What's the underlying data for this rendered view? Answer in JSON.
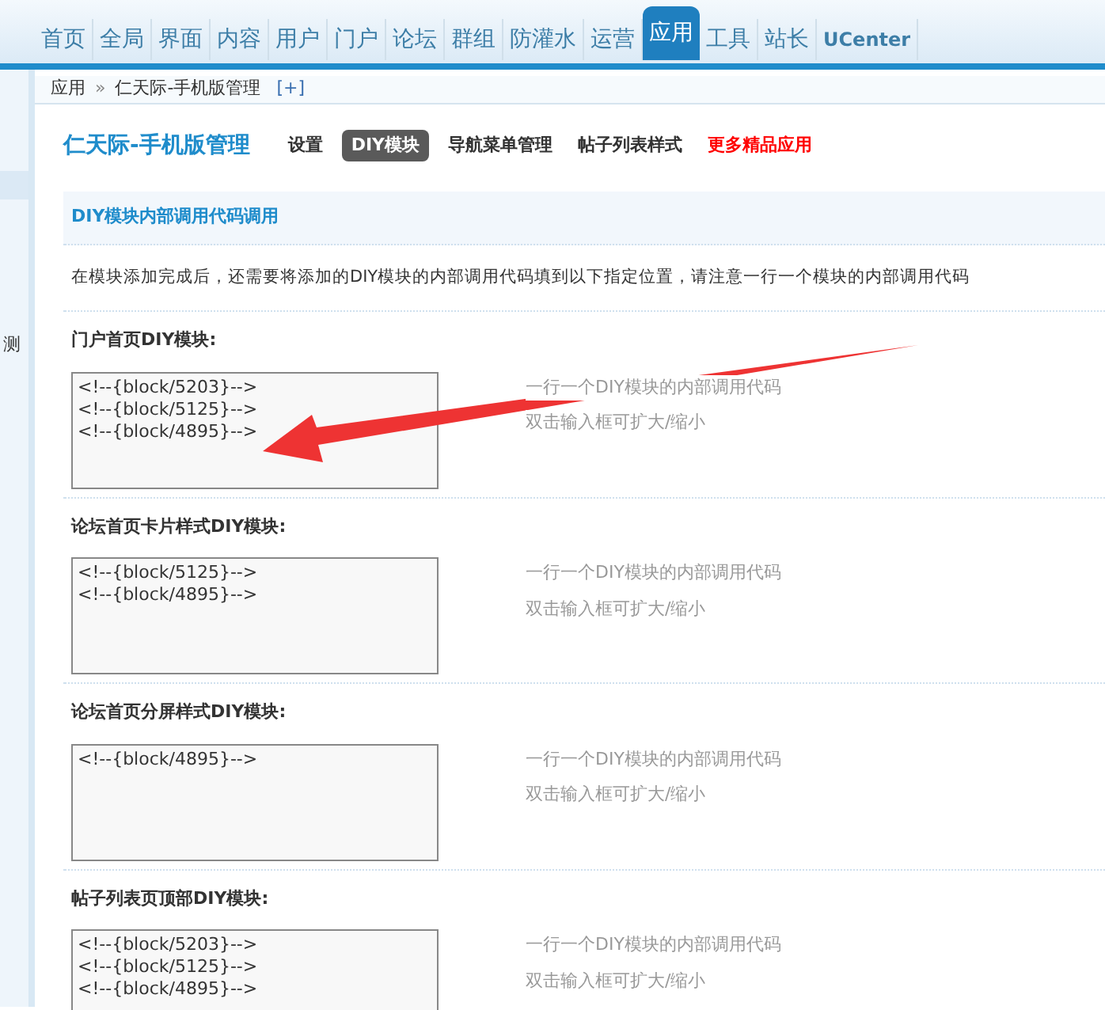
{
  "nav": {
    "items": [
      {
        "label": "首页",
        "selected": false
      },
      {
        "label": "全局",
        "selected": false
      },
      {
        "label": "界面",
        "selected": false
      },
      {
        "label": "内容",
        "selected": false
      },
      {
        "label": "用户",
        "selected": false
      },
      {
        "label": "门户",
        "selected": false
      },
      {
        "label": "论坛",
        "selected": false
      },
      {
        "label": "群组",
        "selected": false
      },
      {
        "label": "防灌水",
        "selected": false
      },
      {
        "label": "运营",
        "selected": false
      },
      {
        "label": "应用",
        "selected": true
      },
      {
        "label": "工具",
        "selected": false
      },
      {
        "label": "站长",
        "selected": false
      },
      {
        "label": "UCenter",
        "selected": false
      }
    ]
  },
  "sidebar": {
    "items": [
      {
        "label": "测"
      }
    ]
  },
  "breadcrumb": {
    "root": "应用",
    "separator": "»",
    "current": "仁天际-手机版管理",
    "add": "[+]"
  },
  "plugin": {
    "title": "仁天际-手机版管理",
    "tabs": [
      {
        "label": "设置",
        "selected": false,
        "kind": "normal"
      },
      {
        "label": "DIY模块",
        "selected": true,
        "kind": "normal"
      },
      {
        "label": "导航菜单管理",
        "selected": false,
        "kind": "normal"
      },
      {
        "label": "帖子列表样式",
        "selected": false,
        "kind": "normal"
      },
      {
        "label": "更多精品应用",
        "selected": false,
        "kind": "promo"
      }
    ]
  },
  "panel": {
    "title": "DIY模块内部调用代码调用",
    "description": "在模块添加完成后，还需要将添加的DIY模块的内部调用代码填到以下指定位置，请注意一行一个模块的内部调用代码"
  },
  "sections": [
    {
      "label": "门户首页DIY模块:",
      "value": "<!--{block/5203}-->\n<!--{block/5125}-->\n<!--{block/4895}-->",
      "hints": [
        "一行一个DIY模块的内部调用代码",
        "双击输入框可扩大/缩小"
      ]
    },
    {
      "label": "论坛首页卡片样式DIY模块:",
      "value": "<!--{block/5125}-->\n<!--{block/4895}-->",
      "hints": [
        "一行一个DIY模块的内部调用代码",
        "双击输入框可扩大/缩小"
      ]
    },
    {
      "label": "论坛首页分屏样式DIY模块:",
      "value": "<!--{block/4895}-->",
      "hints": [
        "一行一个DIY模块的内部调用代码",
        "双击输入框可扩大/缩小"
      ]
    },
    {
      "label": "帖子列表页顶部DIY模块:",
      "value": "<!--{block/5203}-->\n<!--{block/5125}-->\n<!--{block/4895}-->",
      "hints": [
        "一行一个DIY模块的内部调用代码",
        "双击输入框可扩大/缩小"
      ]
    }
  ]
}
